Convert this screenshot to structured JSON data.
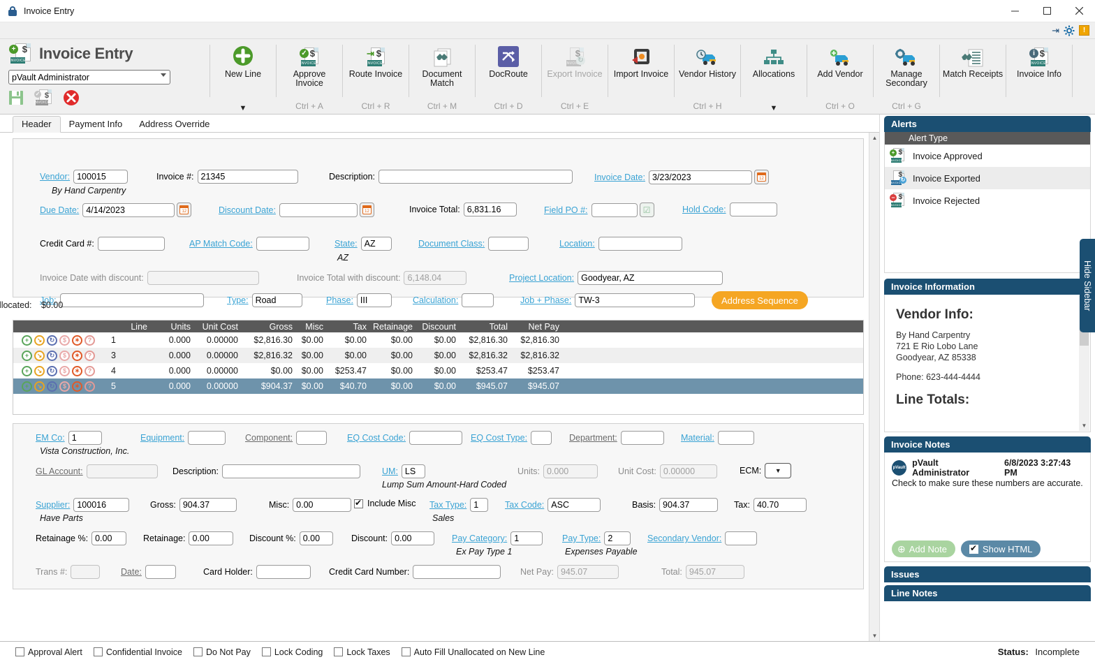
{
  "window": {
    "title": "Invoice Entry",
    "minimize": "—",
    "maximize": "▢",
    "close": "✕"
  },
  "brand": {
    "title": "Invoice Entry",
    "user": "pVault Administrator"
  },
  "ribbon": {
    "buttons": [
      {
        "label": "New Line",
        "key": "",
        "caret": "▼",
        "disabled": false,
        "icon": "plus-circle-icon"
      },
      {
        "label": "Approve\nInvoice",
        "key": "Ctrl + A",
        "caret": "",
        "disabled": false,
        "icon": "approve-invoice-icon"
      },
      {
        "label": "Route Invoice",
        "key": "Ctrl + R",
        "caret": "",
        "disabled": false,
        "icon": "route-invoice-icon"
      },
      {
        "label": "Document\nMatch",
        "key": "Ctrl + M",
        "caret": "",
        "disabled": false,
        "icon": "document-match-icon"
      },
      {
        "label": "DocRoute",
        "key": "Ctrl + D",
        "caret": "",
        "disabled": false,
        "icon": "docroute-icon"
      },
      {
        "label": "Export Invoice",
        "key": "Ctrl + E",
        "caret": "",
        "disabled": true,
        "icon": "export-invoice-icon"
      },
      {
        "label": "Import Invoice",
        "key": "",
        "caret": "",
        "disabled": false,
        "icon": "import-invoice-icon"
      },
      {
        "label": "Vendor History",
        "key": "Ctrl + H",
        "caret": "",
        "disabled": false,
        "icon": "vendor-history-icon"
      },
      {
        "label": "Allocations",
        "key": "",
        "caret": "▼",
        "disabled": false,
        "icon": "allocations-icon"
      },
      {
        "label": "Add Vendor",
        "key": "Ctrl + O",
        "caret": "",
        "disabled": false,
        "icon": "add-vendor-icon"
      },
      {
        "label": "Manage\nSecondary",
        "key": "Ctrl + G",
        "caret": "",
        "disabled": false,
        "icon": "manage-secondary-icon"
      },
      {
        "label": "Match Receipts",
        "key": "",
        "caret": "",
        "disabled": false,
        "icon": "match-receipts-icon"
      },
      {
        "label": "Invoice Info",
        "key": "",
        "caret": "",
        "disabled": false,
        "icon": "invoice-info-icon"
      }
    ]
  },
  "tabs": [
    {
      "label": "Header",
      "active": true
    },
    {
      "label": "Payment Info",
      "active": false
    },
    {
      "label": "Address Override",
      "active": false
    }
  ],
  "header": {
    "vendor_label": "Vendor:",
    "vendor_value": "100015",
    "vendor_name": "By Hand Carpentry",
    "invoice_no_label": "Invoice #:",
    "invoice_no_value": "21345",
    "description_label": "Description:",
    "description_value": "",
    "invoice_date_label": "Invoice Date:",
    "invoice_date_value": "3/23/2023",
    "due_date_label": "Due Date:",
    "due_date_value": "4/14/2023",
    "discount_date_label": "Discount Date:",
    "discount_date_value": "",
    "invoice_total_label": "Invoice Total:",
    "invoice_total_value": "6,831.16",
    "field_po_label": "Field PO #:",
    "field_po_value": "",
    "hold_code_label": "Hold Code:",
    "hold_code_value": "",
    "credit_card_label": "Credit Card #:",
    "credit_card_value": "",
    "ap_match_label": "AP Match Code:",
    "ap_match_value": "",
    "state_label": "State:",
    "state_value": "AZ",
    "state_sub": "AZ",
    "document_class_label": "Document Class:",
    "document_class_value": "",
    "location_label": "Location:",
    "location_value": "",
    "inv_date_disc_label": "Invoice Date with discount:",
    "inv_date_disc_value": "",
    "inv_total_disc_label": "Invoice Total with discount:",
    "inv_total_disc_value": "6,148.04",
    "project_location_label": "Project Location:",
    "project_location_value": "Goodyear, AZ",
    "job_label": "Job:",
    "job_value": "",
    "type_label": "Type:",
    "type_value": "Road",
    "phase_label": "Phase:",
    "phase_value": "III",
    "calculation_label": "Calculation:",
    "calculation_value": "",
    "job_phase_label": "Job + Phase:",
    "job_phase_value": "TW-3",
    "address_sequence_button": "Address Sequence",
    "unallocated_label": "Unallocated:",
    "unallocated_value": "$0.00"
  },
  "grid": {
    "columns": [
      "Line",
      "Units",
      "Unit Cost",
      "Gross",
      "Misc",
      "Tax",
      "Retainage",
      "Discount",
      "Total",
      "Net Pay"
    ],
    "row_icons": [
      "add-icon",
      "move-icon",
      "refresh-icon",
      "dollar-icon",
      "delete-icon",
      "help-icon"
    ],
    "rows": [
      {
        "line": "1",
        "units": "0.000",
        "unit_cost": "0.00000",
        "gross": "$2,816.30",
        "misc": "$0.00",
        "tax": "$0.00",
        "retainage": "$0.00",
        "discount": "$0.00",
        "total": "$2,816.30",
        "net_pay": "$2,816.30",
        "selected": false
      },
      {
        "line": "3",
        "units": "0.000",
        "unit_cost": "0.00000",
        "gross": "$2,816.32",
        "misc": "$0.00",
        "tax": "$0.00",
        "retainage": "$0.00",
        "discount": "$0.00",
        "total": "$2,816.32",
        "net_pay": "$2,816.32",
        "selected": false
      },
      {
        "line": "4",
        "units": "0.000",
        "unit_cost": "0.00000",
        "gross": "$0.00",
        "misc": "$0.00",
        "tax": "$253.47",
        "retainage": "$0.00",
        "discount": "$0.00",
        "total": "$253.47",
        "net_pay": "$253.47",
        "selected": false
      },
      {
        "line": "5",
        "units": "0.000",
        "unit_cost": "0.00000",
        "gross": "$904.37",
        "misc": "$0.00",
        "tax": "$40.70",
        "retainage": "$0.00",
        "discount": "$0.00",
        "total": "$945.07",
        "net_pay": "$945.07",
        "selected": true
      }
    ]
  },
  "detail": {
    "em_co_label": "EM Co:",
    "em_co_value": "1",
    "em_co_sub": "Vista Construction, Inc.",
    "equipment_label": "Equipment:",
    "equipment_value": "",
    "component_label": "Component:",
    "component_value": "",
    "eq_cost_code_label": "EQ Cost Code:",
    "eq_cost_code_value": "",
    "eq_cost_type_label": "EQ Cost Type:",
    "eq_cost_type_value": "",
    "department_label": "Department:",
    "department_value": "",
    "material_label": "Material:",
    "material_value": "",
    "gl_account_label": "GL Account:",
    "gl_account_value": "",
    "description_label": "Description:",
    "description_value": "",
    "um_label": "UM:",
    "um_value": "LS",
    "um_sub": "Lump Sum Amount-Hard Coded",
    "units_label": "Units:",
    "units_value": "0.000",
    "unit_cost_label": "Unit Cost:",
    "unit_cost_value": "0.00000",
    "ecm_label": "ECM:",
    "ecm_value": "",
    "supplier_label": "Supplier:",
    "supplier_value": "100016",
    "supplier_sub": "Have Parts",
    "gross_label": "Gross:",
    "gross_value": "904.37",
    "misc_label": "Misc:",
    "misc_value": "0.00",
    "include_misc_label": "Include Misc",
    "include_misc_checked": true,
    "tax_type_label": "Tax Type:",
    "tax_type_value": "1",
    "tax_type_sub": "Sales",
    "tax_code_label": "Tax Code:",
    "tax_code_value": "ASC",
    "basis_label": "Basis:",
    "basis_value": "904.37",
    "tax_label": "Tax:",
    "tax_value": "40.70",
    "retainage_pct_label": "Retainage %:",
    "retainage_pct_value": "0.00",
    "retainage_label": "Retainage:",
    "retainage_value": "0.00",
    "discount_pct_label": "Discount %:",
    "discount_pct_value": "0.00",
    "discount_label": "Discount:",
    "discount_value": "0.00",
    "pay_category_label": "Pay Category:",
    "pay_category_value": "1",
    "pay_category_sub": "Ex Pay Type 1",
    "pay_type_label": "Pay Type:",
    "pay_type_value": "2",
    "pay_type_sub": "Expenses Payable",
    "secondary_vendor_label": "Secondary Vendor:",
    "secondary_vendor_value": "",
    "trans_label": "Trans #:",
    "trans_value": "",
    "date_label": "Date:",
    "date_value": "",
    "card_holder_label": "Card Holder:",
    "card_holder_value": "",
    "credit_card_number_label": "Credit Card Number:",
    "credit_card_number_value": "",
    "net_pay_label": "Net Pay:",
    "net_pay_value": "945.07",
    "total_label": "Total:",
    "total_value": "945.07"
  },
  "footer": {
    "checkboxes": [
      {
        "label": "Approval Alert",
        "checked": false
      },
      {
        "label": "Confidential Invoice",
        "checked": false
      },
      {
        "label": "Do Not Pay",
        "checked": false
      },
      {
        "label": "Lock Coding",
        "checked": false
      },
      {
        "label": "Lock Taxes",
        "checked": false
      },
      {
        "label": "Auto Fill Unallocated on New Line",
        "checked": false
      }
    ],
    "status_label": "Status:",
    "status_value": "Incomplete"
  },
  "sidebar": {
    "hide_label": "Hide Sidebar",
    "alerts": {
      "title": "Alerts",
      "column": "Alert Type",
      "items": [
        {
          "label": "Invoice Approved",
          "icon": "invoice-approved-icon"
        },
        {
          "label": "Invoice Exported",
          "icon": "invoice-exported-icon"
        },
        {
          "label": "Invoice Rejected",
          "icon": "invoice-rejected-icon"
        }
      ]
    },
    "invoice_information": {
      "title": "Invoice Information",
      "vendor_info_heading": "Vendor Info:",
      "vendor_lines": [
        "By Hand Carpentry",
        "721 E Rio Lobo Lane",
        "Goodyear, AZ 85338"
      ],
      "phone": "Phone: 623-444-4444",
      "line_totals_heading": "Line Totals:"
    },
    "invoice_notes": {
      "title": "Invoice Notes",
      "author": "pVault Administrator",
      "timestamp": "6/8/2023 3:27:43 PM",
      "body": "Check to make sure these numbers are accurate.",
      "add_note_label": "Add Note",
      "show_html_label": "Show HTML",
      "show_html_checked": true,
      "avatar_text": "pVault"
    },
    "issues_title": "Issues",
    "line_notes_title": "Line Notes"
  },
  "colors": {
    "accent": "#1b4f72",
    "orange": "#f5a623",
    "link": "#3aa3d4",
    "header_gray": "#595959"
  }
}
